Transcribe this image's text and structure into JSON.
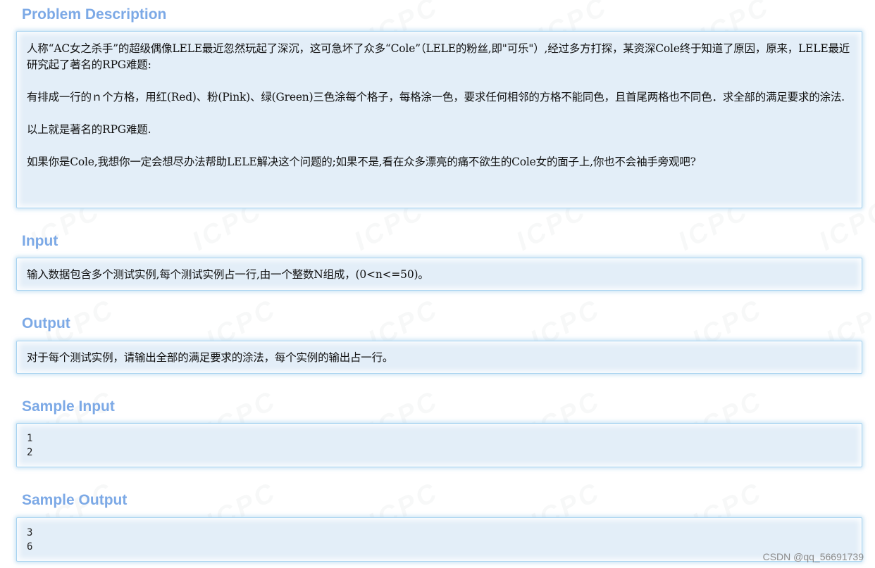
{
  "sections": {
    "problem_description": {
      "title": "Problem Description",
      "paragraphs": [
        "人称“AC女之杀手”的超级偶像LELE最近忽然玩起了深沉，这可急坏了众多“Cole”（LELE的粉丝,即\"可乐\"）,经过多方打探，某资深Cole终于知道了原因，原来，LELE最近研究起了著名的RPG难题:",
        "有排成一行的ｎ个方格，用红(Red)、粉(Pink)、绿(Green)三色涂每个格子，每格涂一色，要求任何相邻的方格不能同色，且首尾两格也不同色．求全部的满足要求的涂法.",
        "以上就是著名的RPG难题.",
        "如果你是Cole,我想你一定会想尽办法帮助LELE解决这个问题的;如果不是,看在众多漂亮的痛不欲生的Cole女的面子上,你也不会袖手旁观吧?"
      ]
    },
    "input": {
      "title": "Input",
      "text": "输入数据包含多个测试实例,每个测试实例占一行,由一个整数N组成，(0<n<=50)。"
    },
    "output": {
      "title": "Output",
      "text": "对于每个测试实例，请输出全部的满足要求的涂法，每个实例的输出占一行。"
    },
    "sample_input": {
      "title": "Sample Input",
      "lines": [
        "1",
        "2"
      ]
    },
    "sample_output": {
      "title": "Sample Output",
      "lines": [
        "3",
        "6"
      ]
    }
  },
  "footer": {
    "credit": "CSDN @qq_56691739"
  },
  "colors": {
    "title": "#7ca9e6",
    "panel_bg": "#e3eef8",
    "panel_border": "#a8d3f0"
  }
}
